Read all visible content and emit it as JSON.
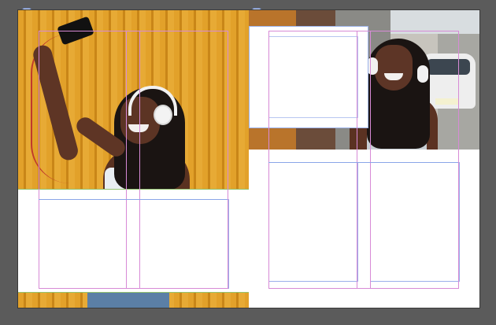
{
  "app": {
    "title": ""
  },
  "canvas": {
    "background": "#5a5a5a"
  },
  "spread": {
    "left_page": {
      "page_tag_icon": "page-badge-icon",
      "photo": {
        "name": "woman-with-phone-and-headphones"
      }
    },
    "right_page": {
      "page_tag_icon": "page-badge-icon",
      "photo": {
        "name": "woman-smiling-on-street"
      }
    }
  },
  "colors": {
    "guide_magenta": "#d78ad6",
    "guide_blue": "#8aa6e8",
    "frame_border": "#9aaeea",
    "bleed_green": "#95c46f"
  }
}
